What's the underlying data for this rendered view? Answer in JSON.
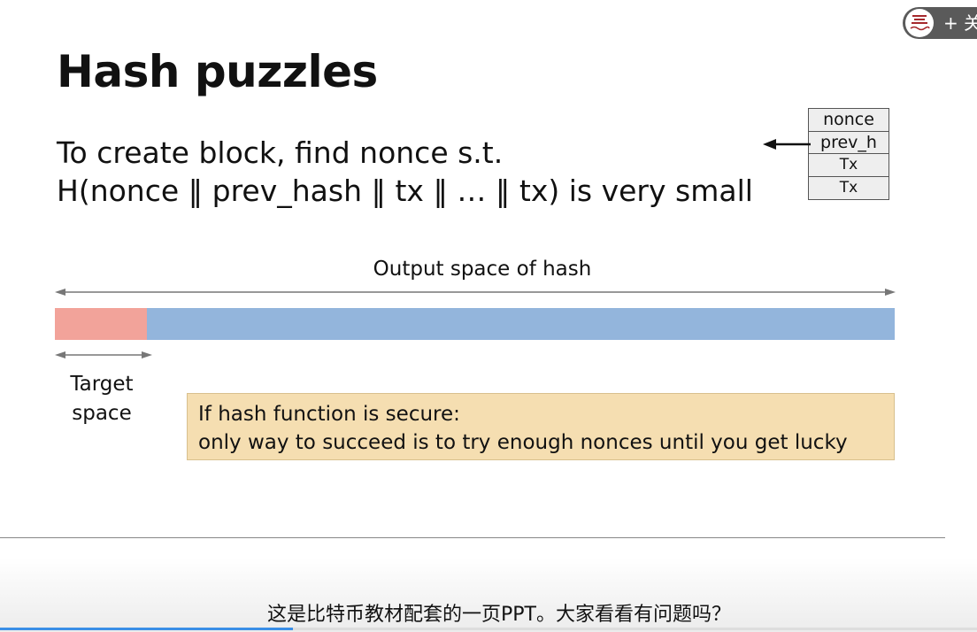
{
  "slide": {
    "title": "Hash puzzles",
    "line1": "To create block, find nonce s.t.",
    "line2": "H(nonce ‖ prev_hash ‖ tx ‖ … ‖ tx) is very small",
    "block_fields": [
      "nonce",
      "prev_h",
      "Tx",
      "Tx"
    ],
    "output_label": "Output space of hash",
    "target_label_line1": "Target",
    "target_label_line2": "space",
    "note_line1": "If hash function is secure:",
    "note_line2": "only way to succeed is to try enough nonces until you get lucky",
    "target_fraction": 0.11
  },
  "player": {
    "subtitle": "这是比特币教材配套的一页PPT。大家看看有问题吗？",
    "follow_label": "+ 关注",
    "progress": 0.3
  },
  "colors": {
    "target_bar": "#f2a39a",
    "output_bar": "#93b5dc",
    "note_bg": "#f5deb1",
    "progress": "#3a8ee6",
    "logo_red": "#a5282c"
  }
}
